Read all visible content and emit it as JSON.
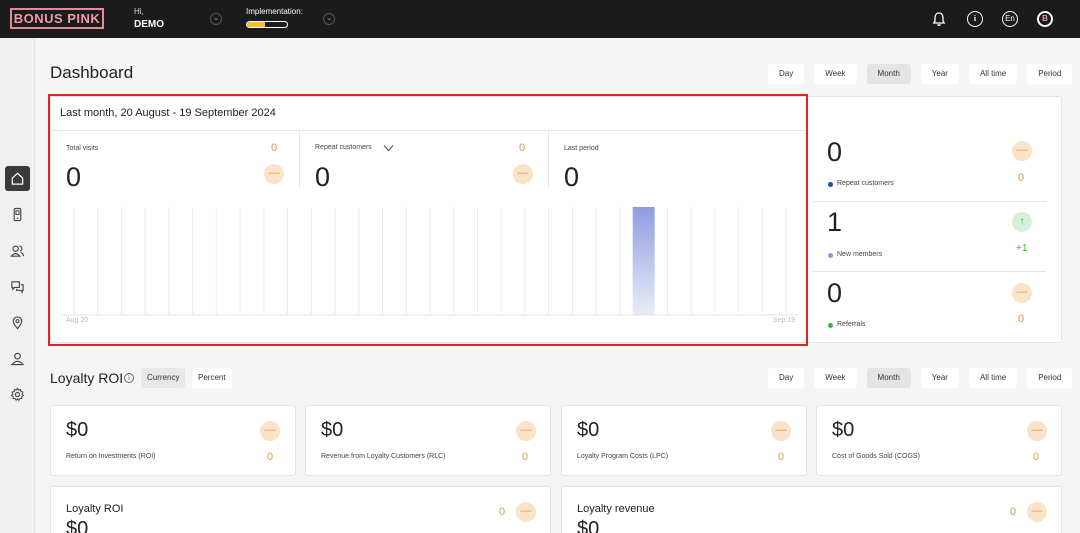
{
  "header": {
    "logo": "BONUS PINK",
    "greeting": "Hi,",
    "user_name": "DEMO",
    "implementation_label": "Implementation:",
    "implementation_progress": 0.45,
    "language": "En",
    "avatar_letter": "B"
  },
  "sidebar": {
    "items": [
      {
        "name": "home-icon",
        "active": true
      },
      {
        "name": "phone-icon",
        "active": false
      },
      {
        "name": "users-icon",
        "active": false
      },
      {
        "name": "chat-icon",
        "active": false
      },
      {
        "name": "location-icon",
        "active": false
      },
      {
        "name": "profile-icon",
        "active": false
      },
      {
        "name": "gear-icon",
        "active": false
      }
    ]
  },
  "dashboard": {
    "title": "Dashboard",
    "period_tabs": [
      "Day",
      "Week",
      "Month",
      "Year",
      "All time",
      "Period"
    ],
    "active_tab": "Month"
  },
  "visits_card": {
    "heading": "Last month, 20 August - 19 September 2024",
    "total_visits": {
      "label": "Total visits",
      "value": "0",
      "delta": "0"
    },
    "repeat_customers": {
      "label": "Repeat customers",
      "value": "0",
      "delta": "0"
    },
    "last_period": {
      "label": "Last period",
      "value": "0"
    },
    "chart": {
      "x_start": "Aug 20",
      "x_end": "Sep 19",
      "bar_count": 31,
      "highlighted_bar_index": 24
    }
  },
  "side_stats": [
    {
      "value": "0",
      "label": "Repeat customers",
      "delta": "0",
      "dot_color": "#2b4aa8",
      "trend": "neutral"
    },
    {
      "value": "1",
      "label": "New members",
      "delta": "+1",
      "dot_color": "#8a9bd8",
      "trend": "up"
    },
    {
      "value": "0",
      "label": "Referrals",
      "delta": "0",
      "dot_color": "#3bb54a",
      "trend": "neutral"
    }
  ],
  "roi": {
    "title": "Loyalty ROI",
    "toggles": [
      "Currency",
      "Percent"
    ],
    "active_toggle": "Currency",
    "period_tabs": [
      "Day",
      "Week",
      "Month",
      "Year",
      "All time",
      "Period"
    ],
    "active_tab": "Month",
    "cards": [
      {
        "value": "$0",
        "label": "Return on Investments (ROI)",
        "delta": "0"
      },
      {
        "value": "$0",
        "label": "Revenue from Loyalty Customers (RLC)",
        "delta": "0"
      },
      {
        "value": "$0",
        "label": "Loyalty Program Costs (LPC)",
        "delta": "0"
      },
      {
        "value": "$0",
        "label": "Cost of Goods Sold (COGS)",
        "delta": "0"
      }
    ],
    "bottom_cards": [
      {
        "title": "Loyalty ROI",
        "value": "$0",
        "delta": "0"
      },
      {
        "title": "Loyalty revenue",
        "value": "$0",
        "delta": "0"
      }
    ]
  }
}
